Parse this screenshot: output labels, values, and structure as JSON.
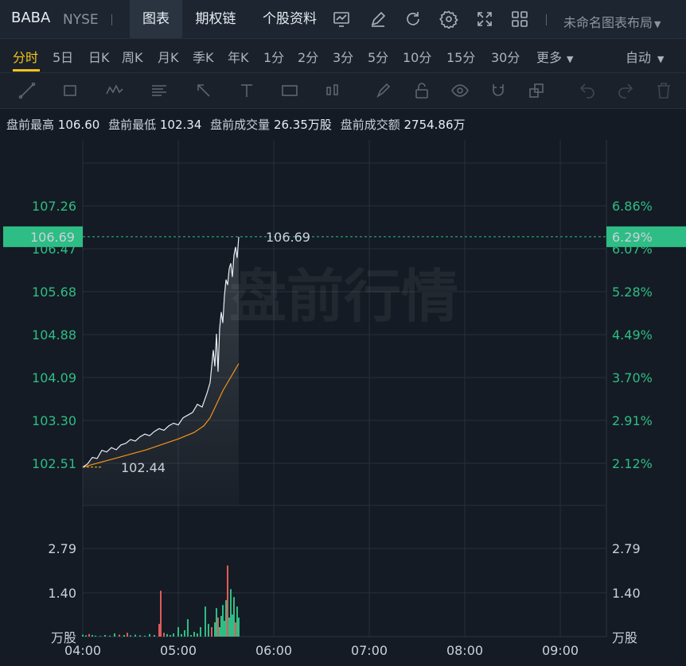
{
  "header": {
    "ticker": "BABA",
    "exchange": "NYSE",
    "tabs": [
      {
        "label": "图表",
        "active": true
      },
      {
        "label": "期权链",
        "active": false
      },
      {
        "label": "个股资料",
        "active": false
      }
    ],
    "icons": [
      "indicator-icon",
      "draw-pen-icon",
      "refresh-icon",
      "settings-icon",
      "fullscreen-icon",
      "grid-layout-icon"
    ],
    "layout_name": "未命名图表布局"
  },
  "intervals": {
    "items": [
      "分时",
      "5日",
      "日K",
      "周K",
      "月K",
      "季K",
      "年K",
      "1分",
      "2分",
      "3分",
      "5分",
      "10分",
      "15分",
      "30分",
      "更多"
    ],
    "active": "分时",
    "scale_mode": "自动"
  },
  "stats": {
    "high_label": "盘前最高",
    "high": "106.60",
    "low_label": "盘前最低",
    "low": "102.34",
    "volume_label": "盘前成交量",
    "volume": "26.35万股",
    "turnover_label": "盘前成交额",
    "turnover": "2754.86万"
  },
  "watermark": "盘前行情",
  "colors": {
    "up": "#2ebd85",
    "down": "#e05b5b",
    "price_line": "#e6edf3",
    "avg_line": "#f7931a",
    "highlight": "#f5c518"
  },
  "chart_data": {
    "type": "line",
    "price_axis": {
      "left_ticks": [
        "107.26",
        "106.47",
        "105.68",
        "104.88",
        "104.09",
        "103.30",
        "102.51"
      ],
      "right_ticks": [
        "6.86%",
        "6.07%",
        "5.28%",
        "4.49%",
        "3.70%",
        "2.91%",
        "2.12%"
      ],
      "range": [
        102.51,
        107.26
      ]
    },
    "current_price": "106.69",
    "current_pct": "6.29%",
    "open_price": "102.44",
    "time_axis": [
      "04:00",
      "05:00",
      "06:00",
      "07:00",
      "08:00",
      "09:00"
    ],
    "price_series": [
      [
        0,
        102.44
      ],
      [
        3,
        102.5
      ],
      [
        6,
        102.62
      ],
      [
        9,
        102.6
      ],
      [
        12,
        102.75
      ],
      [
        15,
        102.72
      ],
      [
        18,
        102.8
      ],
      [
        21,
        102.76
      ],
      [
        24,
        102.85
      ],
      [
        27,
        102.88
      ],
      [
        30,
        102.95
      ],
      [
        33,
        102.92
      ],
      [
        36,
        103.0
      ],
      [
        39,
        103.05
      ],
      [
        42,
        103.02
      ],
      [
        45,
        103.1
      ],
      [
        48,
        103.15
      ],
      [
        51,
        103.12
      ],
      [
        54,
        103.2
      ],
      [
        57,
        103.25
      ],
      [
        60,
        103.22
      ],
      [
        63,
        103.35
      ],
      [
        66,
        103.4
      ],
      [
        69,
        103.45
      ],
      [
        72,
        103.6
      ],
      [
        75,
        103.55
      ],
      [
        78,
        103.8
      ],
      [
        80,
        104.0
      ],
      [
        82,
        104.6
      ],
      [
        83,
        104.3
      ],
      [
        84,
        104.9
      ],
      [
        85,
        104.2
      ],
      [
        86,
        105.0
      ],
      [
        87,
        105.3
      ],
      [
        88,
        105.1
      ],
      [
        89,
        105.6
      ],
      [
        90,
        105.9
      ],
      [
        91,
        105.8
      ],
      [
        92,
        106.1
      ],
      [
        93,
        106.2
      ],
      [
        94,
        105.95
      ],
      [
        95,
        106.35
      ],
      [
        96,
        106.5
      ],
      [
        97,
        106.3
      ],
      [
        98,
        106.69
      ]
    ],
    "avg_series": [
      [
        0,
        102.44
      ],
      [
        10,
        102.52
      ],
      [
        20,
        102.6
      ],
      [
        30,
        102.68
      ],
      [
        40,
        102.76
      ],
      [
        50,
        102.86
      ],
      [
        60,
        102.96
      ],
      [
        70,
        103.08
      ],
      [
        76,
        103.2
      ],
      [
        80,
        103.35
      ],
      [
        84,
        103.6
      ],
      [
        88,
        103.85
      ],
      [
        92,
        104.05
      ],
      [
        95,
        104.2
      ],
      [
        98,
        104.35
      ]
    ],
    "volume_axis": {
      "ticks": [
        "2.79",
        "1.40"
      ],
      "unit": "万股",
      "range": [
        0,
        2.79
      ]
    },
    "volume_bars": [
      [
        0,
        0.06,
        "up"
      ],
      [
        2,
        0.04,
        "up"
      ],
      [
        4,
        0.08,
        "down"
      ],
      [
        6,
        0.05,
        "up"
      ],
      [
        8,
        0.03,
        "up"
      ],
      [
        11,
        0.02,
        "up"
      ],
      [
        14,
        0.05,
        "up"
      ],
      [
        17,
        0.03,
        "up"
      ],
      [
        20,
        0.1,
        "up"
      ],
      [
        23,
        0.06,
        "down"
      ],
      [
        26,
        0.05,
        "up"
      ],
      [
        28,
        0.12,
        "down"
      ],
      [
        30,
        0.04,
        "up"
      ],
      [
        33,
        0.06,
        "up"
      ],
      [
        36,
        0.04,
        "up"
      ],
      [
        39,
        0.03,
        "up"
      ],
      [
        42,
        0.08,
        "up"
      ],
      [
        45,
        0.05,
        "up"
      ],
      [
        48,
        0.4,
        "down"
      ],
      [
        49,
        1.45,
        "down"
      ],
      [
        51,
        0.12,
        "down"
      ],
      [
        53,
        0.08,
        "up"
      ],
      [
        55,
        0.05,
        "up"
      ],
      [
        57,
        0.1,
        "up"
      ],
      [
        60,
        0.3,
        "up"
      ],
      [
        62,
        0.08,
        "up"
      ],
      [
        64,
        0.2,
        "up"
      ],
      [
        66,
        0.55,
        "up"
      ],
      [
        68,
        0.05,
        "up"
      ],
      [
        70,
        0.15,
        "up"
      ],
      [
        72,
        0.1,
        "up"
      ],
      [
        74,
        0.3,
        "up"
      ],
      [
        77,
        0.95,
        "up"
      ],
      [
        79,
        0.4,
        "up"
      ],
      [
        81,
        0.3,
        "down"
      ],
      [
        83,
        0.45,
        "up"
      ],
      [
        84,
        0.9,
        "up"
      ],
      [
        85,
        0.6,
        "down"
      ],
      [
        86,
        0.3,
        "up"
      ],
      [
        87,
        0.65,
        "up"
      ],
      [
        88,
        1.0,
        "up"
      ],
      [
        89,
        0.5,
        "up"
      ],
      [
        90,
        1.15,
        "up"
      ],
      [
        91,
        2.25,
        "down"
      ],
      [
        92,
        0.6,
        "up"
      ],
      [
        93,
        1.5,
        "up"
      ],
      [
        94,
        0.7,
        "up"
      ],
      [
        95,
        1.25,
        "up"
      ],
      [
        96,
        0.45,
        "down"
      ],
      [
        97,
        0.95,
        "up"
      ],
      [
        98,
        0.6,
        "up"
      ]
    ]
  }
}
